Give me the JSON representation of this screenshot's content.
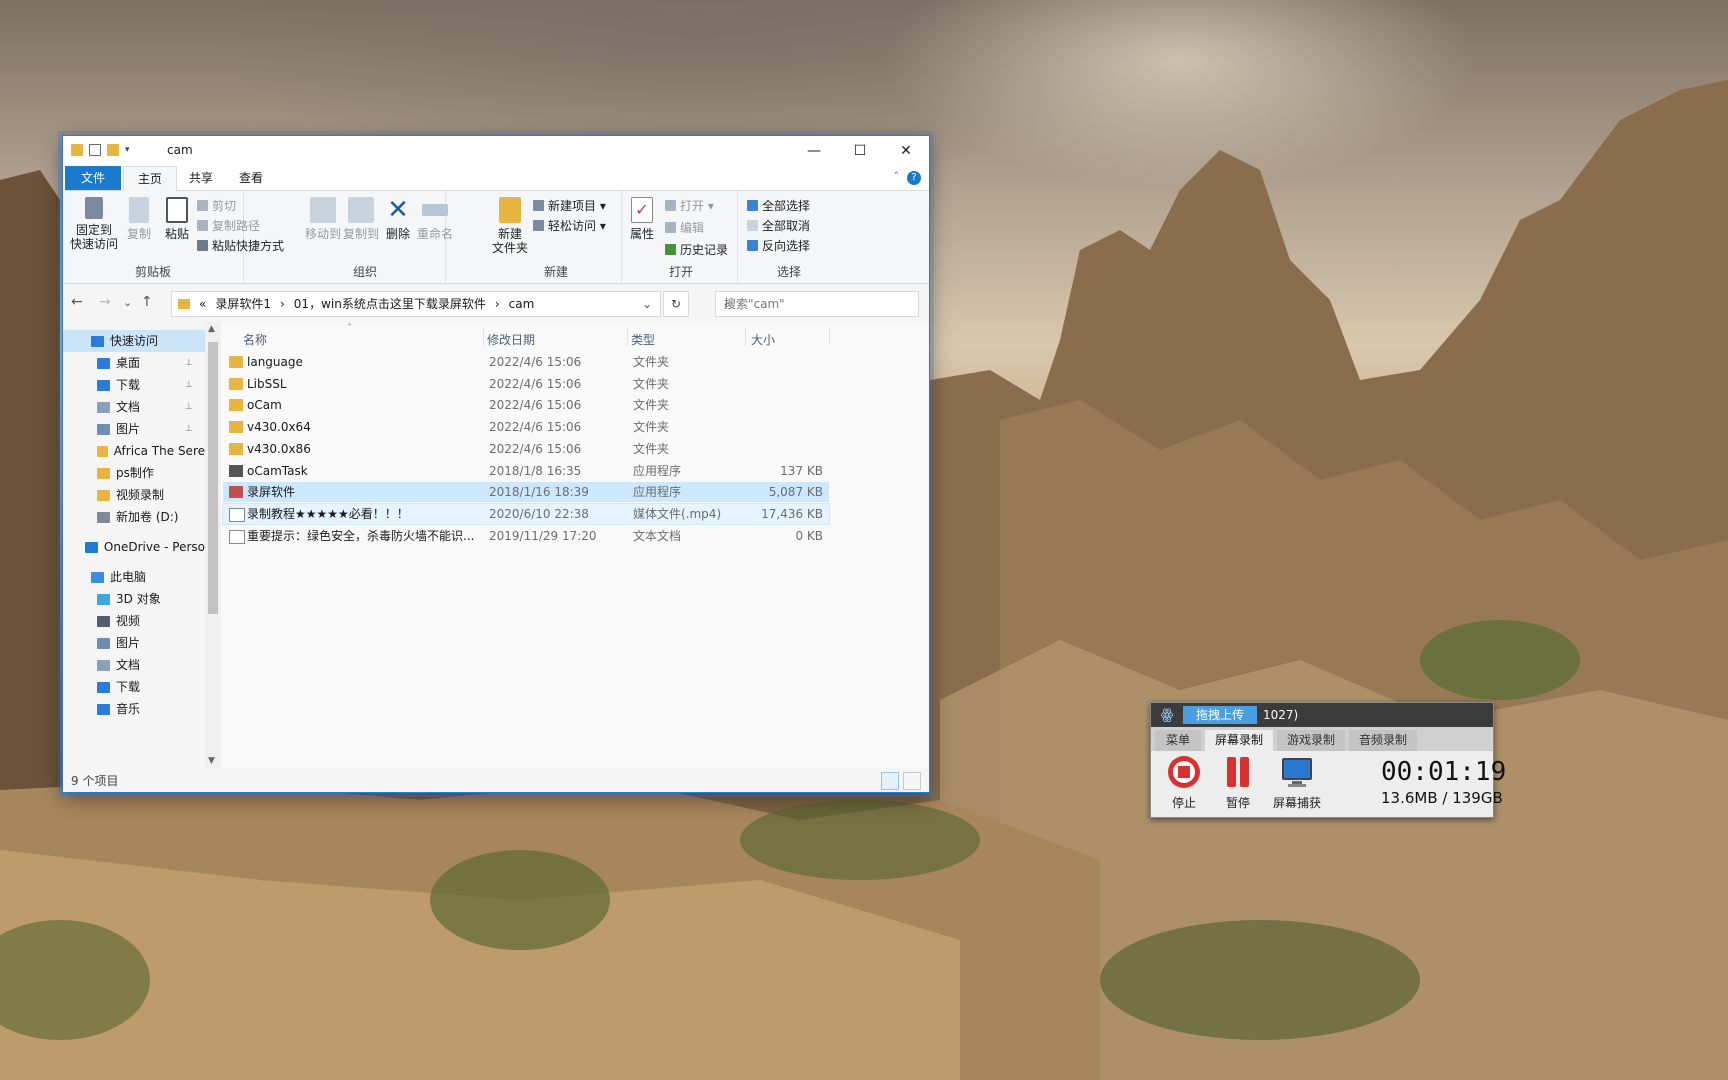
{
  "window": {
    "title": "cam",
    "minimize": "—",
    "maximize": "☐",
    "close": "✕"
  },
  "tabs": {
    "file": "文件",
    "home": "主页",
    "share": "共享",
    "view": "查看",
    "help": "?"
  },
  "ribbon": {
    "clipboard": {
      "label": "剪贴板",
      "pin": "固定到\n快速访问",
      "pin_l1": "固定到",
      "pin_l2": "快速访问",
      "copy": "复制",
      "paste": "粘贴",
      "cut": "剪切",
      "copy_path": "复制路径",
      "paste_shortcut": "粘贴快捷方式"
    },
    "organize": {
      "label": "组织",
      "move_to": "移动到",
      "copy_to": "复制到",
      "delete": "删除",
      "rename": "重命名"
    },
    "new": {
      "label": "新建",
      "new_folder_l1": "新建",
      "new_folder_l2": "文件夹",
      "new_item": "新建项目 ▾",
      "easy_access": "轻松访问 ▾"
    },
    "open": {
      "label": "打开",
      "properties": "属性",
      "open": "打开 ▾",
      "edit": "编辑",
      "history": "历史记录"
    },
    "select": {
      "label": "选择",
      "select_all": "全部选择",
      "select_none": "全部取消",
      "invert": "反向选择"
    }
  },
  "address": {
    "back": "←",
    "forward": "→",
    "recent": "⌄",
    "up": "↑",
    "crumbs": [
      "«",
      "录屏软件1",
      "›",
      "01，win系统点击这里下载录屏软件",
      "›",
      "cam"
    ],
    "dropdown": "⌄",
    "refresh": "↻",
    "search_placeholder": "搜索\"cam\"",
    "search_icon": "⌕"
  },
  "nav": {
    "items": [
      {
        "label": "快速访问",
        "icon": "star-icon",
        "color": "#2b7bd8"
      },
      {
        "label": "桌面",
        "icon": "desktop-icon",
        "color": "#2b7bd8"
      },
      {
        "label": "下载",
        "icon": "download-icon",
        "color": "#2b7bd8"
      },
      {
        "label": "文档",
        "icon": "document-icon",
        "color": "#8aa0b8"
      },
      {
        "label": "图片",
        "icon": "picture-icon",
        "color": "#6e8db0"
      },
      {
        "label": "Africa The Sere",
        "icon": "folder-icon",
        "color": "#e8b540"
      },
      {
        "label": "ps制作",
        "icon": "folder-icon",
        "color": "#e8b540"
      },
      {
        "label": "视频录制",
        "icon": "folder-icon",
        "color": "#e8b540"
      },
      {
        "label": "新加卷 (D:)",
        "icon": "drive-icon",
        "color": "#7f8a96"
      },
      {
        "label": "OneDrive - Perso",
        "icon": "cloud-icon",
        "color": "#1f7ad6"
      },
      {
        "label": "此电脑",
        "icon": "computer-icon",
        "color": "#3a8ee0"
      },
      {
        "label": "3D 对象",
        "icon": "cube-icon",
        "color": "#3fa7d9"
      },
      {
        "label": "视频",
        "icon": "video-icon",
        "color": "#555e6b"
      },
      {
        "label": "图片",
        "icon": "picture-icon",
        "color": "#6e8db0"
      },
      {
        "label": "文档",
        "icon": "document-icon",
        "color": "#8aa0b8"
      },
      {
        "label": "下载",
        "icon": "download-icon",
        "color": "#2b7bd8"
      },
      {
        "label": "音乐",
        "icon": "music-icon",
        "color": "#2b7bd8"
      }
    ],
    "pin_glyph": "📌"
  },
  "columns": {
    "name": "名称",
    "date": "修改日期",
    "type": "类型",
    "size": "大小",
    "sort_arrow": "˄"
  },
  "files": [
    {
      "name": "language",
      "date": "2022/4/6 15:06",
      "type": "文件夹",
      "size": "",
      "icon": "folder-icon",
      "color": "#e8b540"
    },
    {
      "name": "LibSSL",
      "date": "2022/4/6 15:06",
      "type": "文件夹",
      "size": "",
      "icon": "folder-icon",
      "color": "#e8b540"
    },
    {
      "name": "oCam",
      "date": "2022/4/6 15:06",
      "type": "文件夹",
      "size": "",
      "icon": "folder-icon",
      "color": "#e8b540"
    },
    {
      "name": "v430.0x64",
      "date": "2022/4/6 15:06",
      "type": "文件夹",
      "size": "",
      "icon": "folder-icon",
      "color": "#e8b540"
    },
    {
      "name": "v430.0x86",
      "date": "2022/4/6 15:06",
      "type": "文件夹",
      "size": "",
      "icon": "folder-icon",
      "color": "#e8b540"
    },
    {
      "name": "oCamTask",
      "date": "2018/1/8 16:35",
      "type": "应用程序",
      "size": "137 KB",
      "icon": "app-icon",
      "color": "#555555"
    },
    {
      "name": "录屏软件",
      "date": "2018/1/16 18:39",
      "type": "应用程序",
      "size": "5,087 KB",
      "icon": "app-icon",
      "color": "#c0504d"
    },
    {
      "name": "录制教程★★★★★必看！！！",
      "date": "2020/6/10 22:38",
      "type": "媒体文件(.mp4)",
      "size": "17,436 KB",
      "icon": "video-file-icon",
      "color": "#ffffff"
    },
    {
      "name": "重要提示：绿色安全，杀毒防火墙不能识...",
      "date": "2019/11/29 17:20",
      "type": "文本文档",
      "size": "0 KB",
      "icon": "text-file-icon",
      "color": "#ffffff"
    }
  ],
  "status": {
    "count": "9 个项目"
  },
  "ocam": {
    "logo": "ꙮ",
    "upload": "拖拽上传",
    "title": "1027)",
    "tabs": [
      "菜单",
      "屏幕录制",
      "游戏录制",
      "音频录制"
    ],
    "stop": "停止",
    "pause": "暂停",
    "capture": "屏幕捕获",
    "time": "00:01:19",
    "size": "13.6MB / 139GB",
    "colors": {
      "stop": "#d93030",
      "pause": "#d93030",
      "monitor": "#2a78d0"
    }
  }
}
